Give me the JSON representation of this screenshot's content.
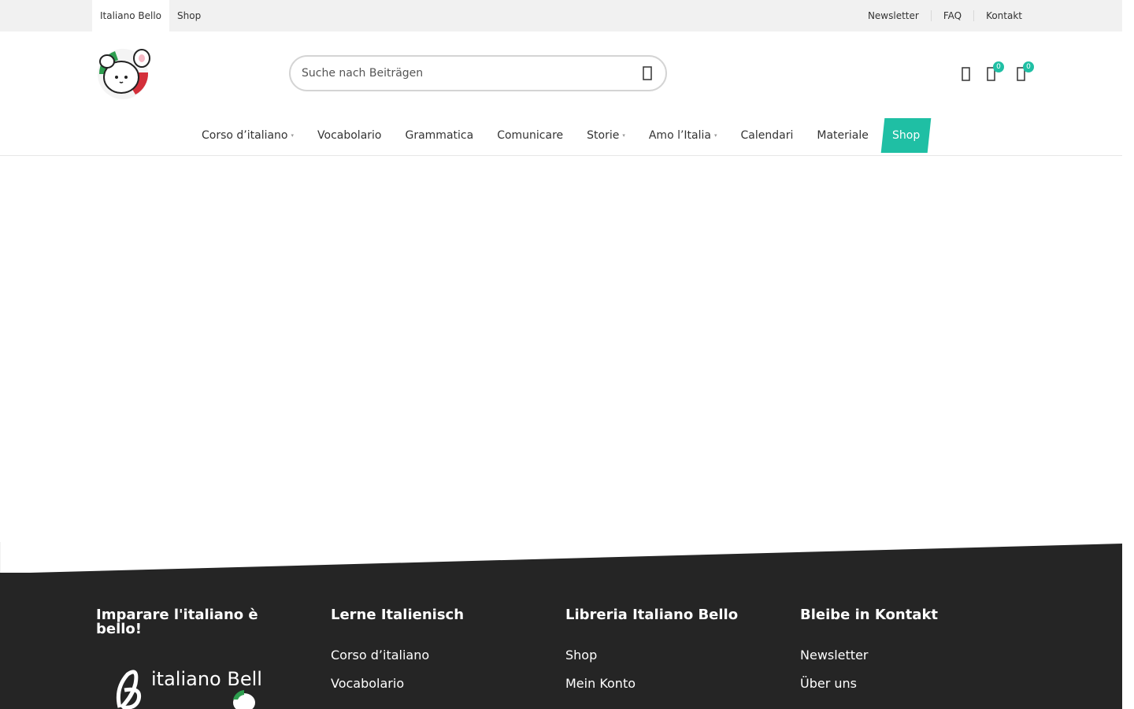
{
  "topbar": {
    "left": [
      "Italiano Bello",
      "Shop"
    ],
    "right": [
      "Newsletter",
      "FAQ",
      "Kontakt"
    ]
  },
  "search": {
    "placeholder": "Suche nach Beiträgen"
  },
  "header_icons": {
    "user": "user-icon",
    "wishlist": {
      "icon": "heart-icon",
      "count": "0"
    },
    "cart": {
      "icon": "shopping-bag-icon",
      "count": "0"
    }
  },
  "nav": {
    "items": [
      {
        "label": "Corso d’italiano",
        "has_submenu": true
      },
      {
        "label": "Vocabolario",
        "has_submenu": false
      },
      {
        "label": "Grammatica",
        "has_submenu": false
      },
      {
        "label": "Comunicare",
        "has_submenu": false
      },
      {
        "label": "Storie",
        "has_submenu": true
      },
      {
        "label": "Amo l’Italia",
        "has_submenu": true
      },
      {
        "label": "Calendari",
        "has_submenu": false
      },
      {
        "label": "Materiale",
        "has_submenu": false
      },
      {
        "label": "Shop",
        "has_submenu": false
      }
    ],
    "caret": "▾"
  },
  "footer": {
    "col1": {
      "title": "Imparare l'italiano è bello!",
      "logo_text": "italiano Bello"
    },
    "col2": {
      "title": "Lerne Italienisch",
      "links": [
        "Corso d’italiano",
        "Vocabolario"
      ]
    },
    "col3": {
      "title": "Libreria Italiano Bello",
      "links": [
        "Shop",
        "Mein Konto"
      ]
    },
    "col4": {
      "title": "Bleibe in Kontakt",
      "links": [
        "Newsletter",
        "Über uns"
      ]
    }
  },
  "colors": {
    "accent": "#1fbfa4",
    "footer_bg": "#252525",
    "topbar_bg": "#f1f1f1"
  }
}
